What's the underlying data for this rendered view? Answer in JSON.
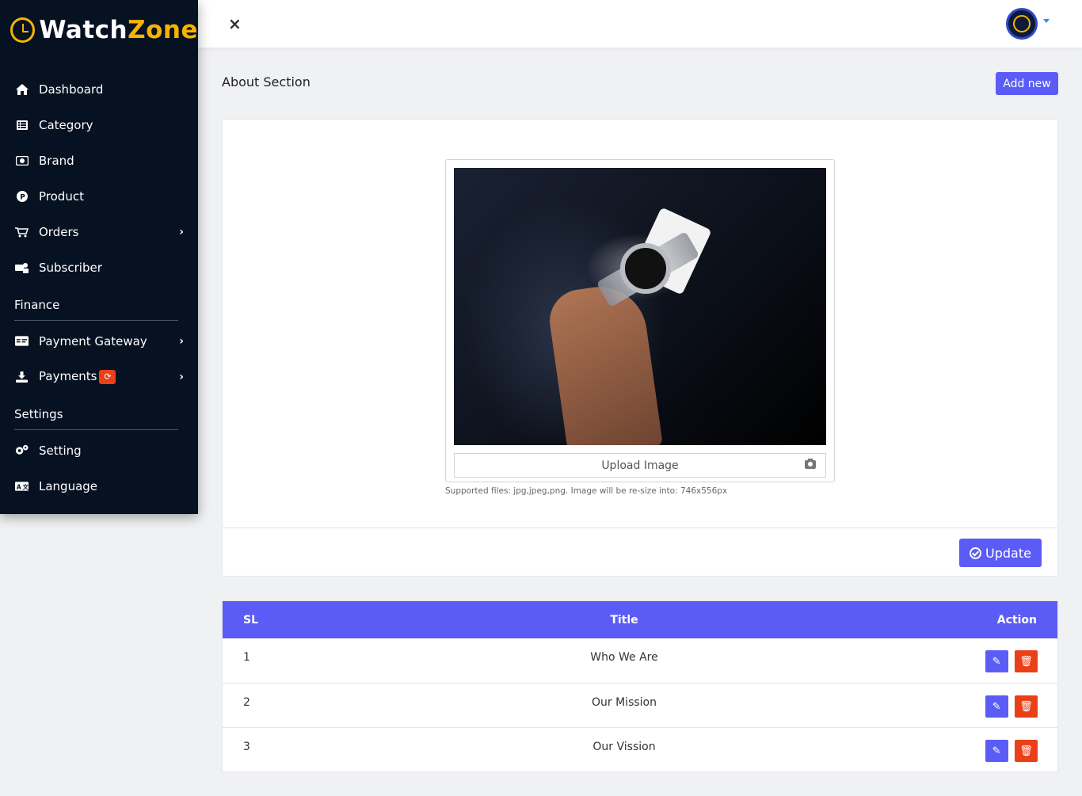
{
  "brand": {
    "name_part1": "Watch",
    "name_part2": "Zone"
  },
  "sidebar": {
    "items": [
      {
        "label": "Dashboard",
        "icon": "home-icon"
      },
      {
        "label": "Category",
        "icon": "list-icon"
      },
      {
        "label": "Brand",
        "icon": "brand-icon"
      },
      {
        "label": "Product",
        "icon": "product-icon"
      },
      {
        "label": "Orders",
        "icon": "cart-icon",
        "has_submenu": true
      },
      {
        "label": "Subscriber",
        "icon": "subscriber-icon"
      }
    ],
    "finance_section": "Finance",
    "finance_items": [
      {
        "label": "Payment Gateway",
        "icon": "credit-card-icon",
        "has_submenu": true
      },
      {
        "label": "Payments",
        "icon": "download-icon",
        "has_submenu": true,
        "badge": "⟳"
      }
    ],
    "settings_section": "Settings",
    "settings_items": [
      {
        "label": "Setting",
        "icon": "gears-icon"
      },
      {
        "label": "Language",
        "icon": "language-icon"
      }
    ]
  },
  "topbar": {
    "close_symbol": "×"
  },
  "page": {
    "title": "About Section",
    "add_new_label": "Add new"
  },
  "upload": {
    "field_label": "Upload Image",
    "supported_text": "Supported files: jpg,jpeg,png. Image will be re-size into: 746x556px"
  },
  "update_label": "Update",
  "table": {
    "headers": {
      "sl": "SL",
      "title": "Title",
      "action": "Action"
    },
    "rows": [
      {
        "sl": "1",
        "title": "Who We Are"
      },
      {
        "sl": "2",
        "title": "Our Mission"
      },
      {
        "sl": "3",
        "title": "Our Vission"
      }
    ]
  },
  "colors": {
    "sidebar_bg": "#061122",
    "accent": "#5b5cf5",
    "brand_yellow": "#f5b400",
    "danger": "#e9401a"
  }
}
